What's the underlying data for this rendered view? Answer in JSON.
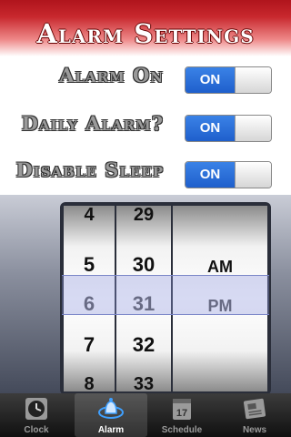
{
  "header": {
    "title": "Alarm Settings"
  },
  "settings": [
    {
      "label": "Alarm On",
      "state": "ON"
    },
    {
      "label": "Daily Alarm?",
      "state": "ON"
    },
    {
      "label": "Disable Sleep",
      "state": "ON"
    }
  ],
  "picker": {
    "hours": [
      "4",
      "5",
      "6",
      "7",
      "8"
    ],
    "minutes": [
      "29",
      "30",
      "31",
      "32",
      "33"
    ],
    "ampm": [
      "AM",
      "PM"
    ],
    "selected": {
      "hour": "6",
      "minute": "31",
      "ampm": "PM"
    }
  },
  "tabbar": {
    "tabs": [
      {
        "label": "Clock",
        "icon": "clock-icon",
        "active": false
      },
      {
        "label": "Alarm",
        "icon": "alarm-bell-icon",
        "active": true
      },
      {
        "label": "Schedule",
        "icon": "calendar-icon",
        "active": false,
        "icon_text": "17"
      },
      {
        "label": "News",
        "icon": "newspaper-icon",
        "active": false
      }
    ]
  },
  "colors": {
    "header_red": "#b0141c",
    "toggle_blue": "#1f5fcc",
    "label_gray": "#9a9a9a"
  }
}
